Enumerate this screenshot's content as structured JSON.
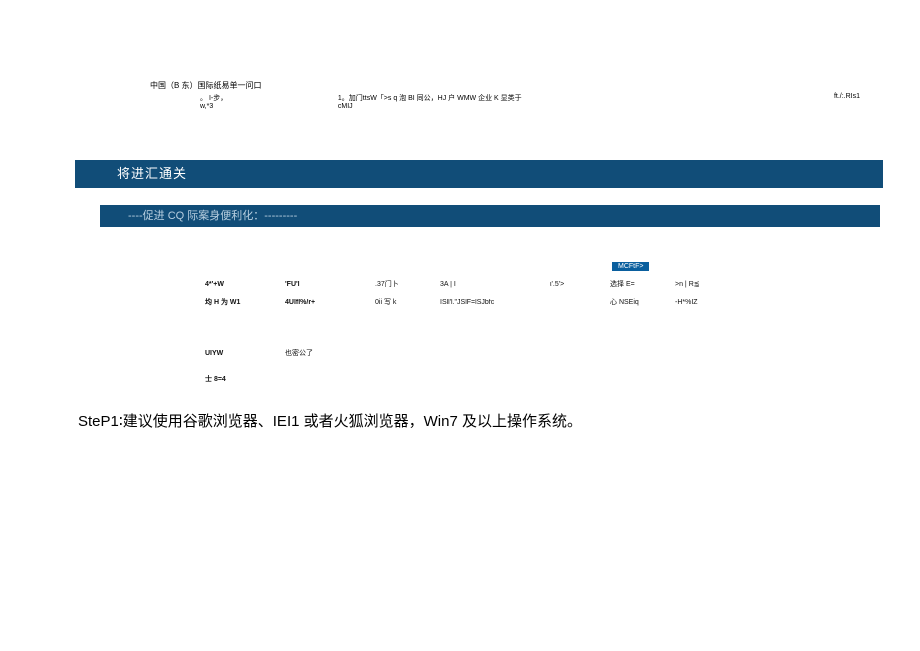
{
  "header": {
    "title": "中国（B 东）国际纸易单一问口",
    "sub1": "。 I-步，w,*3",
    "sub2": "1。加门ttsW「>s q 泡 BI 同公，HJ 户 WMW 企业 K 显类于cMIJ",
    "sub3": "ft./:.RIs1"
  },
  "banner1": "将进汇通关",
  "banner2": "----促进 CQ 际案身便利化：---------",
  "tag": "MCFtF>",
  "grid": {
    "row1": {
      "c1": "4*'+W",
      "c2": "'FU'l",
      "c3": ".37门卜",
      "c4": "3A   |   I",
      "c5": "ι'.5'>",
      "c6": "选择 E=",
      "c7": ">n  |  R⪅"
    },
    "row2": {
      "c1": "均 H 为 W1",
      "c2": "4Ulfl%/r+",
      "c3": "0ii 写 k",
      "c4": "ISll'l.\"JSlF=lSJbfc",
      "c5": "",
      "c6": "心 NSEiq",
      "c7": "-H*%IZ"
    }
  },
  "small": {
    "row1": {
      "c1": "UIYW",
      "c2": "也密公了"
    },
    "row2": {
      "c1": "士 8=4",
      "c2": ""
    }
  },
  "step": "SteP1∶建议使用谷歌浏览器、IEI1 或者火狐浏览器，Win7 及以上操作系统。"
}
